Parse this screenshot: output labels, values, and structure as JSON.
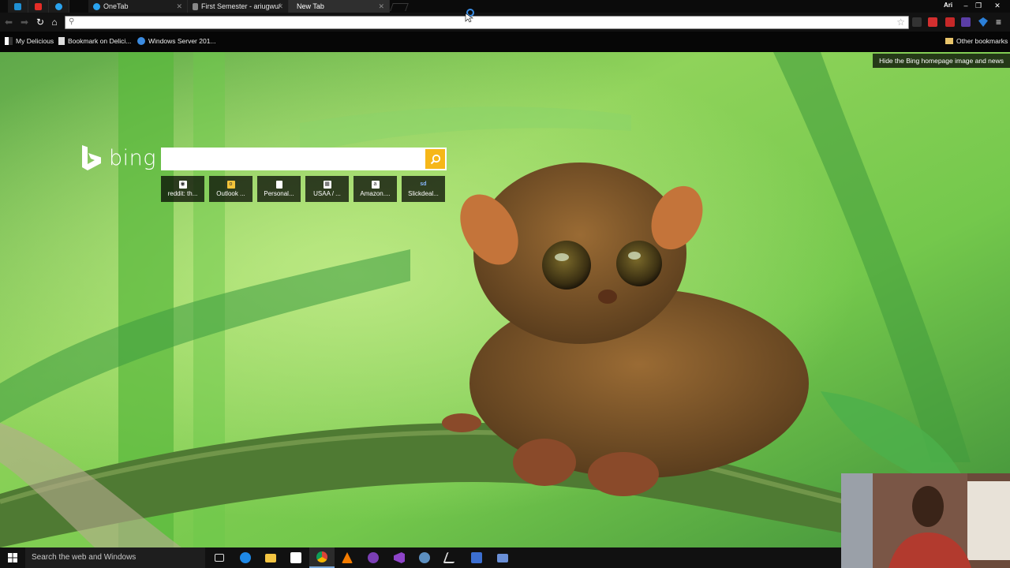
{
  "browser": {
    "tabs": [
      {
        "label": "",
        "icon": "trello-icon",
        "color": "#1f8fd2",
        "pinned": true
      },
      {
        "label": "",
        "icon": "youtube-icon",
        "color": "#e52d27",
        "pinned": true
      },
      {
        "label": "",
        "icon": "twitter-icon",
        "color": "#2aa3ef",
        "pinned": true
      },
      {
        "label": "OneTab",
        "icon": "onetab-icon",
        "color": "#2aa3ef"
      },
      {
        "label": "First Semester - ariugwu/",
        "icon": "document-icon",
        "color": "#888888"
      },
      {
        "label": "New Tab",
        "icon": "",
        "color": "",
        "active": true
      }
    ],
    "user": "Ari",
    "omnibox": {
      "value": "",
      "placeholder": ""
    },
    "bookmarks": [
      {
        "label": "My Delicious",
        "icon": "delicious-icon"
      },
      {
        "label": "Bookmark on Delici...",
        "icon": "page-icon"
      },
      {
        "label": "Windows Server 201...",
        "icon": "ie-icon"
      }
    ],
    "other_bookmarks": "Other bookmarks"
  },
  "bing": {
    "logo_text": "bing",
    "hide_link": "Hide the Bing homepage image and news",
    "search": {
      "value": "",
      "placeholder": ""
    },
    "tiles": [
      {
        "label": "reddit: th...",
        "icon": "reddit-icon"
      },
      {
        "label": "Outlook ...",
        "icon": "outlook-icon"
      },
      {
        "label": "Personal...",
        "icon": "document-icon"
      },
      {
        "label": "USAA / ...",
        "icon": "usaa-icon"
      },
      {
        "label": "Amazon....",
        "icon": "amazon-icon"
      },
      {
        "label": "Slickdeal...",
        "icon": "slickdeals-icon"
      }
    ],
    "accent": "#f6b718"
  },
  "taskbar": {
    "search_placeholder": "Search the web and Windows",
    "apps": [
      "task-view-icon",
      "edge-icon",
      "file-explorer-icon",
      "store-icon",
      "chrome-icon",
      "vlc-icon",
      "onenote-icon",
      "visual-studio-icon",
      "steam-icon",
      "app-icon",
      "outlook-app-icon",
      "remote-desktop-icon"
    ]
  }
}
